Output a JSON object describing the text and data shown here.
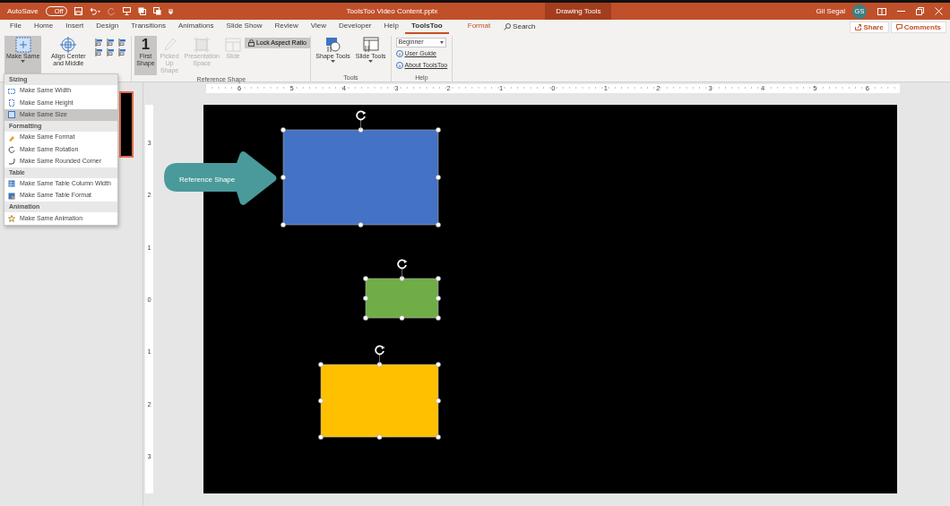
{
  "title_bar": {
    "autosave_label": "AutoSave",
    "autosave_state": "Off",
    "autosave_on": false,
    "document_title": "ToolsToo Video Content.pptx",
    "context_label": "Drawing Tools",
    "user_name": "Gil Segal",
    "user_initials": "GS"
  },
  "menu_tabs": [
    {
      "label": "File",
      "selected": false,
      "kind": "normal"
    },
    {
      "label": "Home",
      "selected": false,
      "kind": "normal"
    },
    {
      "label": "Insert",
      "selected": false,
      "kind": "normal"
    },
    {
      "label": "Design",
      "selected": false,
      "kind": "normal"
    },
    {
      "label": "Transitions",
      "selected": false,
      "kind": "normal"
    },
    {
      "label": "Animations",
      "selected": false,
      "kind": "normal"
    },
    {
      "label": "Slide Show",
      "selected": false,
      "kind": "normal"
    },
    {
      "label": "Review",
      "selected": false,
      "kind": "normal"
    },
    {
      "label": "View",
      "selected": false,
      "kind": "normal"
    },
    {
      "label": "Developer",
      "selected": false,
      "kind": "normal"
    },
    {
      "label": "Help",
      "selected": false,
      "kind": "normal"
    },
    {
      "label": "ToolsToo",
      "selected": true,
      "kind": "normal"
    },
    {
      "label": "Format",
      "selected": false,
      "kind": "contextual"
    }
  ],
  "search": {
    "label": "Search"
  },
  "share_button": "Share",
  "comments_button": "Comments",
  "ribbon_groups": [
    {
      "items": [
        {
          "kind": "large",
          "label": "Make Same",
          "selected": true,
          "disabled": false,
          "has_menu": true
        },
        {
          "kind": "large",
          "label": "Align Center and Middle",
          "selected": false,
          "disabled": false,
          "has_menu": false
        },
        {
          "kind": "align-grid"
        }
      ]
    },
    {
      "label": "Reference Shape",
      "items": [
        {
          "kind": "large",
          "label": "First Shape",
          "icon_text": "1",
          "selected": true,
          "disabled": false,
          "has_menu": false
        },
        {
          "kind": "large",
          "label": "Picked Up Shape",
          "selected": false,
          "disabled": true,
          "has_menu": false
        },
        {
          "kind": "large",
          "label": "Presentation Space",
          "selected": false,
          "disabled": true,
          "has_menu": false
        },
        {
          "kind": "large",
          "label": "Slide",
          "selected": false,
          "disabled": true,
          "has_menu": false
        },
        {
          "kind": "toggle",
          "label": "Lock Aspect Ratio",
          "selected": true
        }
      ]
    },
    {
      "label": "Tools",
      "items": [
        {
          "kind": "large",
          "label": "Shape Tools",
          "selected": false,
          "disabled": false,
          "has_menu": true
        },
        {
          "kind": "large",
          "label": "Slide Tools",
          "selected": false,
          "disabled": false,
          "has_menu": true
        }
      ]
    },
    {
      "label": "Help",
      "items": [
        {
          "kind": "dropdown",
          "value": "Beginner"
        },
        {
          "kind": "link",
          "label": "User Guide"
        },
        {
          "kind": "link",
          "label": "About ToolsToo"
        }
      ]
    }
  ],
  "make_same_menu": [
    {
      "heading": "Sizing",
      "items": [
        {
          "label": "Make Same Width",
          "selected": false
        },
        {
          "label": "Make Same Height",
          "selected": false
        },
        {
          "label": "Make Same Size",
          "selected": true
        }
      ]
    },
    {
      "heading": "Formatting",
      "items": [
        {
          "label": "Make Same Format",
          "selected": false
        },
        {
          "label": "Make Same Rotation",
          "selected": false
        },
        {
          "label": "Make Same Rounded Corner",
          "selected": false
        }
      ]
    },
    {
      "heading": "Table",
      "items": [
        {
          "label": "Make Same Table Column Width",
          "selected": false
        },
        {
          "label": "Make Same Table Format",
          "selected": false
        }
      ]
    },
    {
      "heading": "Animation",
      "items": [
        {
          "label": "Make Same Animation",
          "selected": false
        }
      ]
    }
  ],
  "horizontal_ruler": [
    "6",
    "5",
    "4",
    "3",
    "2",
    "1",
    "0",
    "1",
    "2",
    "3",
    "4",
    "5",
    "6"
  ],
  "vertical_ruler": [
    "3",
    "2",
    "1",
    "0",
    "1",
    "2",
    "3"
  ],
  "slide": {
    "callout": {
      "text": "Reference Shape"
    },
    "shapes": [
      {
        "kind": "rectangle",
        "color": "#4472c4",
        "selected": true
      },
      {
        "kind": "rectangle",
        "color": "#70ad47",
        "selected": true
      },
      {
        "kind": "rectangle",
        "color": "#ffc000",
        "selected": true
      }
    ]
  }
}
